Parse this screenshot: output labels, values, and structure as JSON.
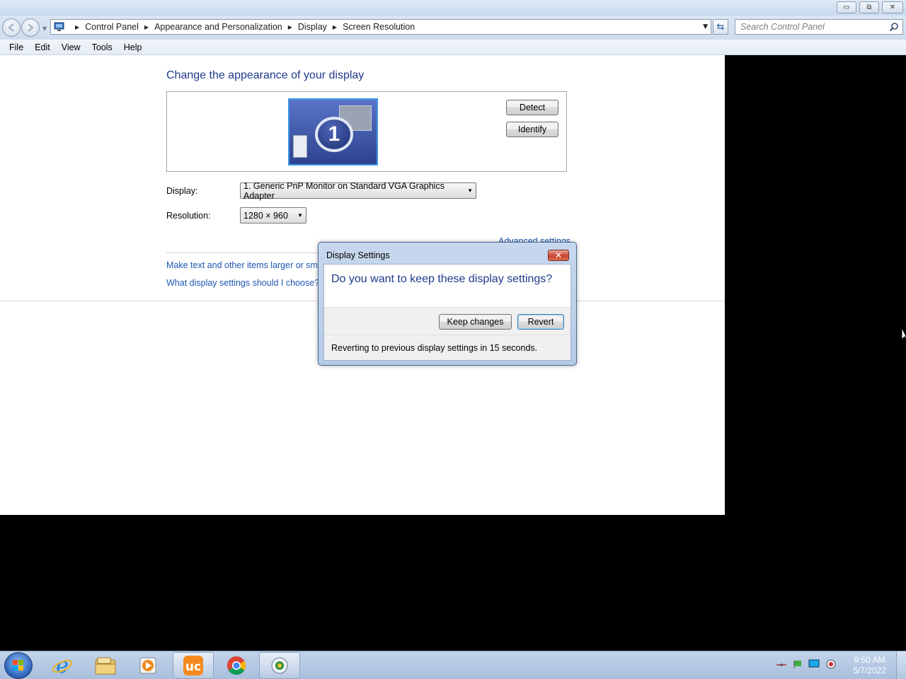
{
  "window": {
    "minimize_glyph": "▭",
    "restore_glyph": "⧉",
    "close_glyph": "✕"
  },
  "address": {
    "breadcrumbs": [
      "Control Panel",
      "Appearance and Personalization",
      "Display",
      "Screen Resolution"
    ],
    "search_placeholder": "Search Control Panel"
  },
  "menu": [
    "File",
    "Edit",
    "View",
    "Tools",
    "Help"
  ],
  "main": {
    "heading": "Change the appearance of your display",
    "monitor_number": "1",
    "detect_label": "Detect",
    "identify_label": "Identify",
    "display_label": "Display:",
    "display_value": "1. Generic PnP Monitor on Standard VGA Graphics Adapter",
    "resolution_label": "Resolution:",
    "resolution_value": "1280 × 960",
    "advanced_link": "Advanced settings",
    "link_text_size": "Make text and other items larger or smaller",
    "link_help": "What display settings should I choose?"
  },
  "dialog": {
    "title": "Display Settings",
    "question": "Do you want to keep these display settings?",
    "keep_label": "Keep changes",
    "revert_label": "Revert",
    "status": "Reverting to previous display settings in 15 seconds."
  },
  "taskbar": {
    "items": [
      "start-orb",
      "internet-explorer",
      "windows-explorer",
      "media-player",
      "uc-browser",
      "chrome",
      "control-panel"
    ],
    "time": "9:50 AM",
    "date": "5/7/2022"
  },
  "colors": {
    "heading": "#1e3a8a",
    "link": "#1e56b4",
    "close_red": "#c9452f",
    "taskbar": "#b6cae4"
  }
}
